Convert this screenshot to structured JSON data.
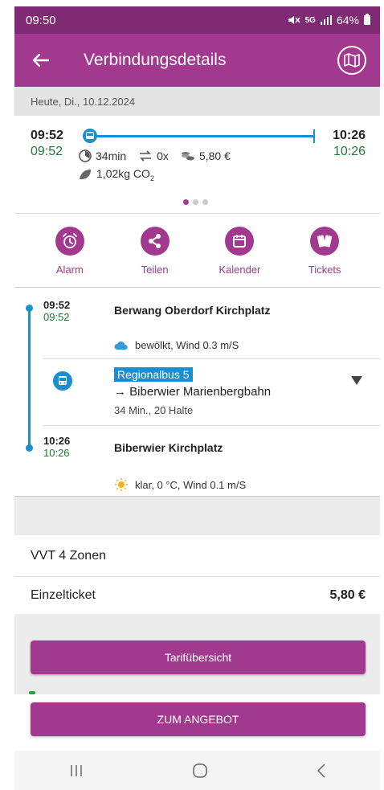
{
  "status_bar": {
    "time": "09:50",
    "network": "5G",
    "battery": "64%"
  },
  "app_bar": {
    "title": "Verbindungsdetails"
  },
  "date_bar": {
    "date": "Heute, Di., 10.12.2024"
  },
  "summary": {
    "departure_planned": "09:52",
    "departure_actual": "09:52",
    "arrival_planned": "10:26",
    "arrival_actual": "10:26",
    "duration": "34min",
    "transfers": "0x",
    "price": "5,80 €",
    "co2_value": "1,02kg CO",
    "co2_sub": "2",
    "page_count": 3,
    "active_page": 0
  },
  "actions": [
    {
      "label": "Alarm",
      "icon": "alarm-icon"
    },
    {
      "label": "Teilen",
      "icon": "share-icon"
    },
    {
      "label": "Kalender",
      "icon": "calendar-icon"
    },
    {
      "label": "Tickets",
      "icon": "tickets-icon"
    }
  ],
  "itinerary": {
    "origin": {
      "time_planned": "09:52",
      "time_actual": "09:52",
      "name": "Berwang Oberdorf Kirchplatz",
      "weather": "bewölkt, Wind 0.3 m/S",
      "weather_icon": "cloud-icon"
    },
    "leg": {
      "line": "Regionalbus 5",
      "direction": "→ Biberwier Marienbergbahn",
      "info": "34 Min., 20 Halte",
      "icon": "bus-icon"
    },
    "destination": {
      "time_planned": "10:26",
      "time_actual": "10:26",
      "name": "Biberwier Kirchplatz",
      "weather": "klar, 0 °C, Wind 0.1 m/S",
      "weather_icon": "sun-icon"
    }
  },
  "tariff": {
    "zone": "VVT 4 Zonen",
    "ticket_name": "Einzelticket",
    "ticket_price": "5,80 €",
    "overview_button": "Tarifübersicht",
    "offer_button": "ZUM ANGEBOT"
  },
  "colors": {
    "primary": "#a3398f",
    "status_bar": "#7f2a72",
    "accent_blue": "#1a8fd0",
    "green_time": "#1f7a3a"
  }
}
